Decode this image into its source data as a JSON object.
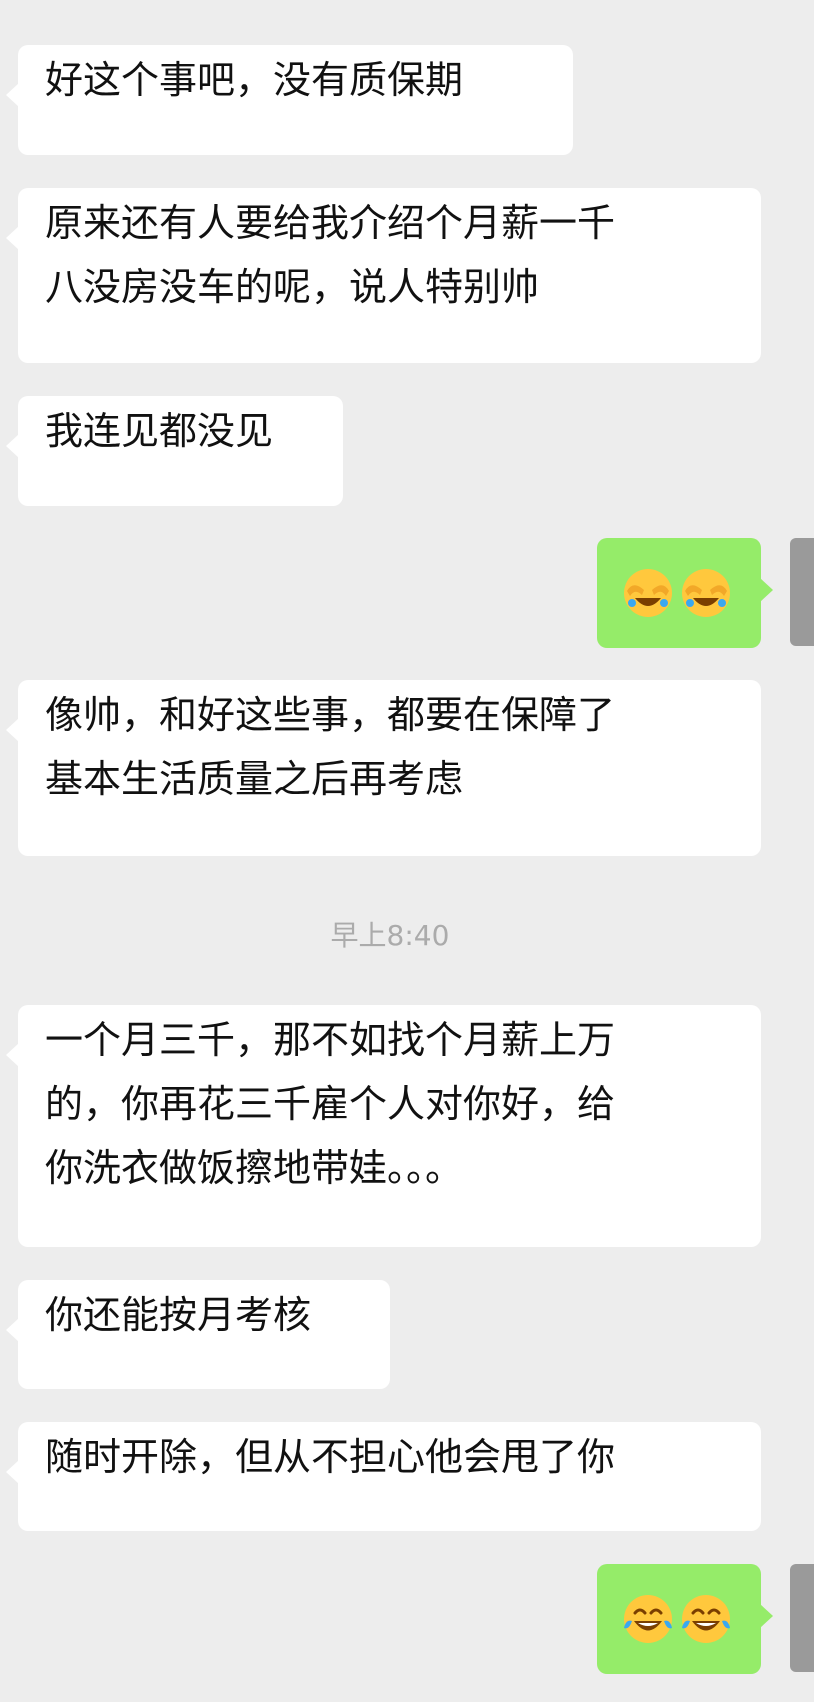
{
  "messages": [
    {
      "side": "in",
      "lines": [
        "好这个事吧，没有质保期"
      ]
    },
    {
      "side": "in",
      "lines": [
        "原来还有人要给我介绍个月薪一千",
        "八没房没车的呢，说人特别帅"
      ]
    },
    {
      "side": "in",
      "lines": [
        "我连见都没见"
      ]
    },
    {
      "side": "out",
      "emojis": [
        "face-covering-eyes-laughing-emoji",
        "face-covering-eyes-laughing-emoji"
      ]
    },
    {
      "side": "in",
      "lines": [
        "像帅，和好这些事，都要在保障了",
        "基本生活质量之后再考虑"
      ]
    },
    {
      "side": "in",
      "lines": [
        "一个月三千，那不如找个月薪上万",
        "的，你再花三千雇个人对你好，给",
        "你洗衣做饭擦地带娃。。。"
      ]
    },
    {
      "side": "in",
      "lines": [
        "你还能按月考核"
      ]
    },
    {
      "side": "in",
      "lines": [
        "随时开除，但从不担心他会甩了你"
      ]
    },
    {
      "side": "out",
      "emojis": [
        "tears-of-joy-emoji",
        "tears-of-joy-emoji"
      ]
    }
  ],
  "timestamp": "早上8:40",
  "colors": {
    "background": "#ededed",
    "incoming_bubble": "#ffffff",
    "outgoing_bubble": "#95ec69",
    "emoji_face": "#ffc83d",
    "emoji_tears": "#3aa8f0",
    "timestamp_text": "#ababab"
  }
}
